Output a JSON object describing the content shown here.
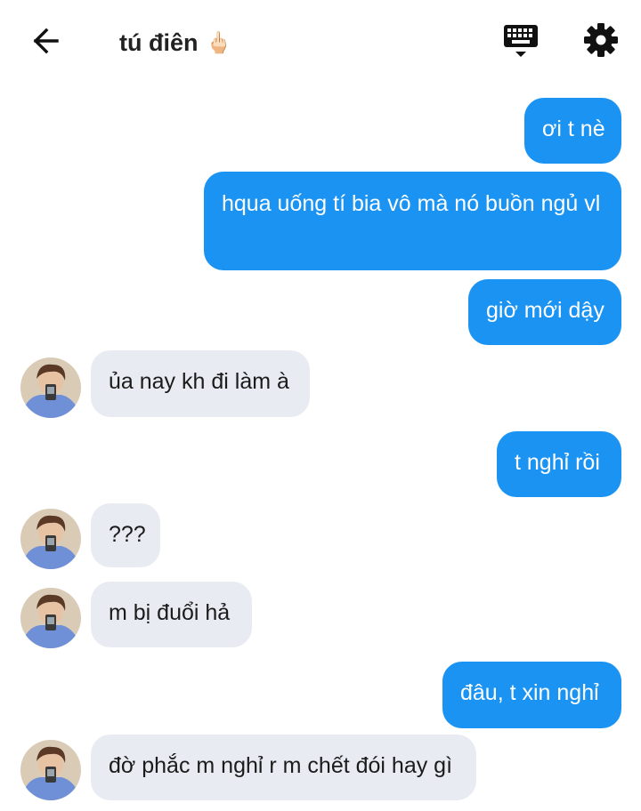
{
  "header": {
    "title": "tú điên",
    "emoji": "🖕🏻"
  },
  "icons": {
    "back": "arrow-left-icon",
    "keyboard": "keyboard-icon",
    "settings": "gear-icon"
  },
  "colors": {
    "outgoing_bubble": "#1a93f3",
    "incoming_bubble": "#e8ecf2"
  },
  "messages": [
    {
      "side": "out",
      "text": "ơi t nè"
    },
    {
      "side": "out",
      "text": "hqua uống tí bia vô mà nó buồn ngủ vl"
    },
    {
      "side": "out",
      "text": "giờ mới dậy"
    },
    {
      "side": "in",
      "text": "ủa nay kh đi làm à"
    },
    {
      "side": "out",
      "text": "t nghỉ rồi"
    },
    {
      "side": "in",
      "text": "???"
    },
    {
      "side": "in",
      "text": "m bị đuổi hả"
    },
    {
      "side": "out",
      "text": "đâu, t xin nghỉ"
    },
    {
      "side": "in",
      "text": "đờ phắc m nghỉ r m chết đói hay gì"
    }
  ]
}
